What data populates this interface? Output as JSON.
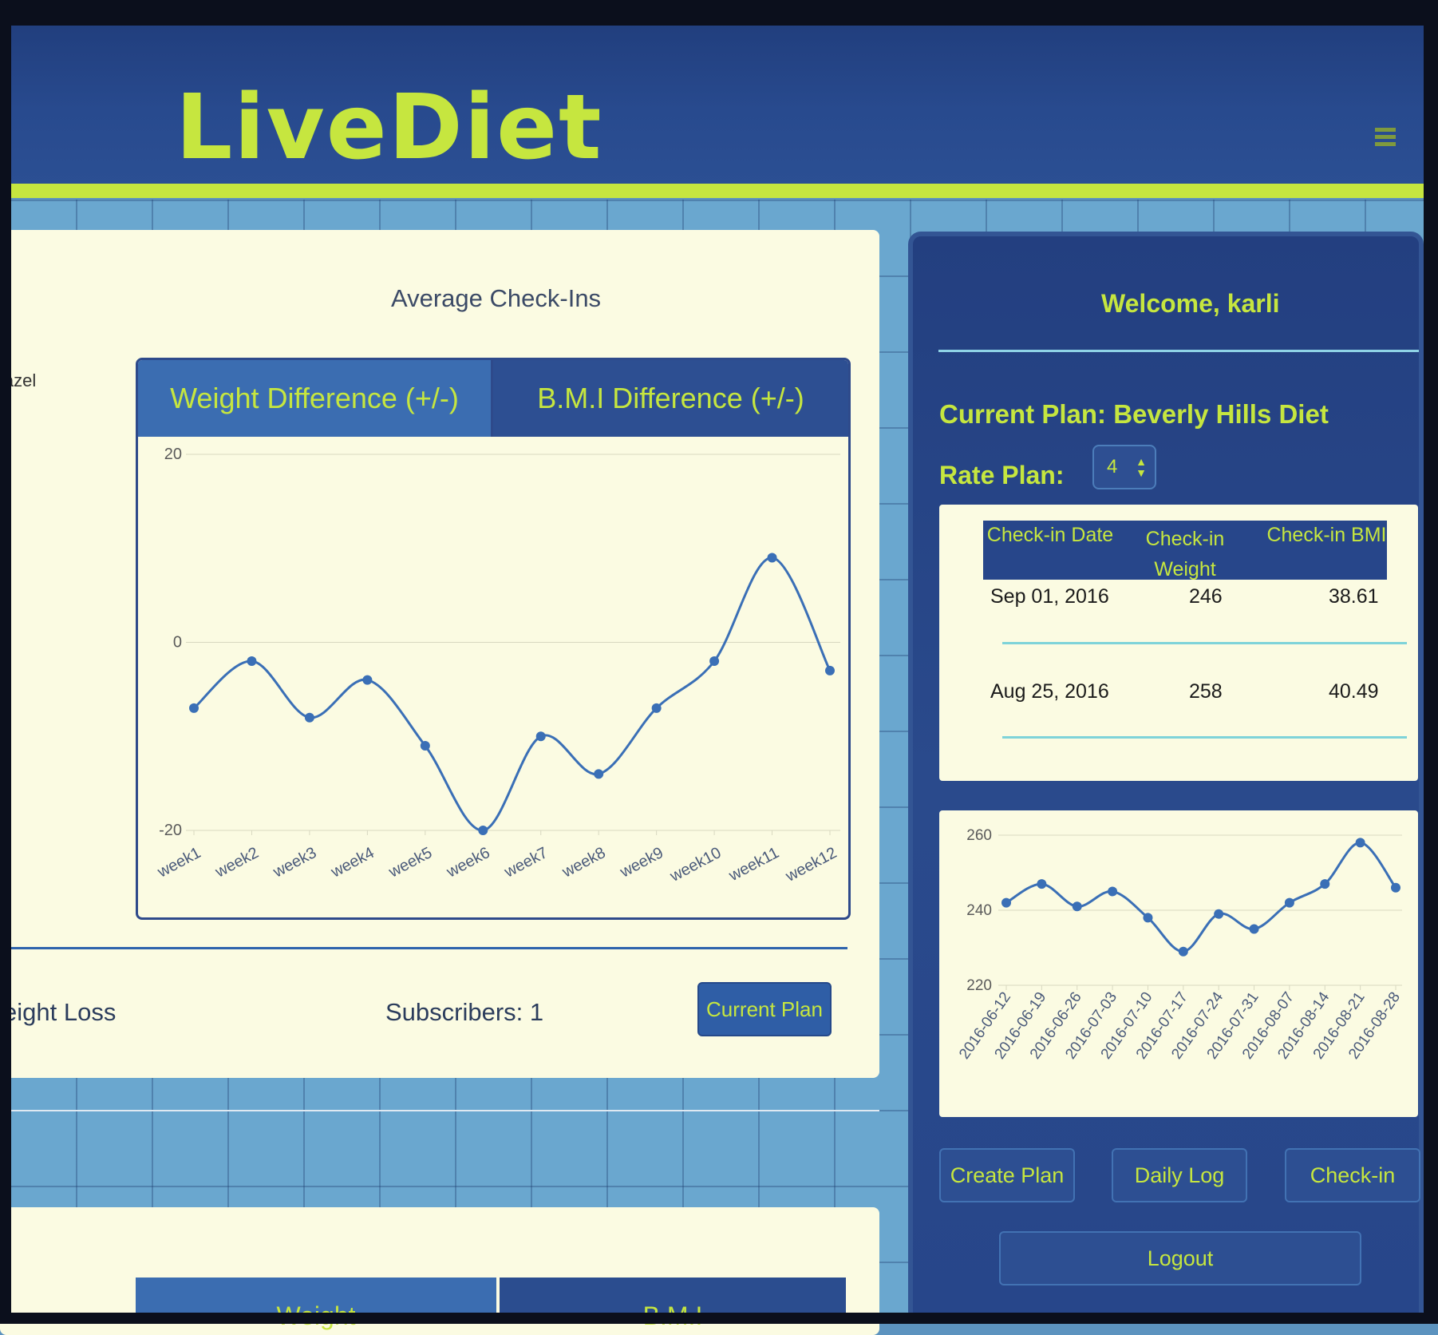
{
  "app": {
    "logo": "LiveDiet"
  },
  "main": {
    "section_title": "Average Check-Ins",
    "left_clipped_name": "lazel",
    "tabs": [
      {
        "label": "Weight Difference (+/-)",
        "active": true
      },
      {
        "label": "B.M.I Difference (+/-)",
        "active": false
      }
    ],
    "footer": {
      "plan_name": "eight Loss",
      "subscribers": "Subscribers: 1",
      "current_plan_button": "Current Plan"
    },
    "bottom_tabs": [
      {
        "label": "Weight"
      },
      {
        "label": "B.M.I"
      }
    ]
  },
  "sidebar": {
    "welcome": "Welcome, karli",
    "current_plan": "Current Plan: Beverly Hills Diet",
    "rate_label": "Rate Plan:",
    "rate_value": "4",
    "table": {
      "headers": [
        "Check-in Date",
        "Check-in\nWeight",
        "Check-in BMI"
      ],
      "rows": [
        {
          "date": "Sep 01, 2016",
          "weight": "246",
          "bmi": "38.61"
        },
        {
          "date": "Aug 25, 2016",
          "weight": "258",
          "bmi": "40.49"
        }
      ]
    },
    "buttons": {
      "create_plan": "Create Plan",
      "daily_log": "Daily Log",
      "check_in": "Check-in",
      "logout": "Logout"
    }
  },
  "colors": {
    "accent": "#c6e63f",
    "navy": "#27468a",
    "panel": "#fbfbe2",
    "line": "#3a6fb6"
  },
  "chart_data": [
    {
      "type": "line",
      "categories": [
        "week1",
        "week2",
        "week3",
        "week4",
        "week5",
        "week6",
        "week7",
        "week8",
        "week9",
        "week10",
        "week11",
        "week12"
      ],
      "series": [
        {
          "values": [
            -7,
            -2,
            -8,
            -4,
            -11,
            -20,
            -10,
            -14,
            -7,
            -2,
            9,
            -3
          ]
        }
      ],
      "yticks": [
        20,
        0,
        -20
      ],
      "ylim": [
        -20,
        20
      ],
      "grid": true
    },
    {
      "type": "line",
      "categories": [
        "2016-06-12",
        "2016-06-19",
        "2016-06-26",
        "2016-07-03",
        "2016-07-10",
        "2016-07-17",
        "2016-07-24",
        "2016-07-31",
        "2016-08-07",
        "2016-08-14",
        "2016-08-21",
        "2016-08-28"
      ],
      "series": [
        {
          "values": [
            242,
            247,
            241,
            245,
            238,
            229,
            239,
            235,
            242,
            247,
            258,
            246
          ]
        }
      ],
      "yticks": [
        260,
        240,
        220
      ],
      "ylim": [
        220,
        260
      ],
      "grid": true
    }
  ]
}
